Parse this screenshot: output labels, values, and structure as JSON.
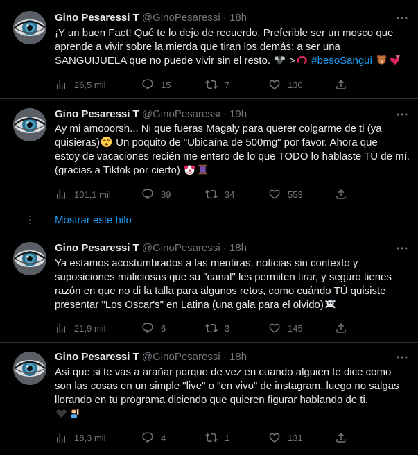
{
  "tweets": [
    {
      "name": "Gino Pesaressi T",
      "handle": "@GinoPesaressi",
      "separator": "·",
      "time": "18h",
      "lines": [
        "¡Y un buen Fact! Qué te lo dejo de recuerdo. Preferible ser un mosco que",
        "aprende a vivir sobre la mierda que tiran los demás; a ser una",
        "SANGUIJUELA que no puede vivir sin el resto."
      ],
      "line3_extra": ">",
      "hashtag": "#besoSangui",
      "stats": {
        "views": "26,5 mil",
        "replies": "15",
        "retweets": "7",
        "likes": "130"
      }
    },
    {
      "name": "Gino Pesaressi T",
      "handle": "@GinoPesaressi",
      "separator": "·",
      "time": "19h",
      "lines": [
        "Ay mi amooorsh... Ni que fueras Magaly para querer colgarme de ti (ya",
        "quisieras)",
        " Un poquito de \"Ubicaína de 500mg\" por favor. Ahora que",
        "estoy de vacaciones recién me entero de lo que TODO lo hablaste TÚ de mí.",
        "(gracias a Tiktok por cierto)"
      ],
      "stats": {
        "views": "101,1 mil",
        "replies": "89",
        "retweets": "34",
        "likes": "553"
      }
    },
    {
      "name": "Gino Pesaressi T",
      "handle": "@GinoPesaressi",
      "separator": "·",
      "time": "18h",
      "lines": [
        "Ya estamos acostumbrados a las mentiras, noticias sin contexto y",
        "suposiciones maliciosas que su \"canal\" les permiten tirar, y seguro tienes",
        "razón en que no di la talla para algunos retos, como cuándo TÚ quisiste",
        "presentar \"Los Oscar's\" en Latina (una gala para el olvido)"
      ],
      "stats": {
        "views": "21,9 mil",
        "replies": "6",
        "retweets": "3",
        "likes": "145"
      }
    },
    {
      "name": "Gino Pesaressi T",
      "handle": "@GinoPesaressi",
      "separator": "·",
      "time": "18h",
      "lines": [
        "Así que si te vas a arañar porque de vez en cuando alguien te dice como",
        "son las cosas en un simple \"live\" o \"en vivo\" de instagram, luego no salgas",
        "llorando en tu programa diciendo que quieren figurar hablando de ti."
      ],
      "stats": {
        "views": "18,3 mil",
        "replies": "4",
        "retweets": "1",
        "likes": "131"
      }
    }
  ],
  "show_thread": "Mostrar este hilo",
  "icons": [
    "views-icon",
    "reply-icon",
    "retweet-icon",
    "like-icon",
    "share-icon",
    "more-icon"
  ],
  "colors": {
    "background": "#000000",
    "text": "#e7e9ea",
    "secondary": "#71767b",
    "link": "#1d9bf0",
    "divider": "#2f3336"
  }
}
